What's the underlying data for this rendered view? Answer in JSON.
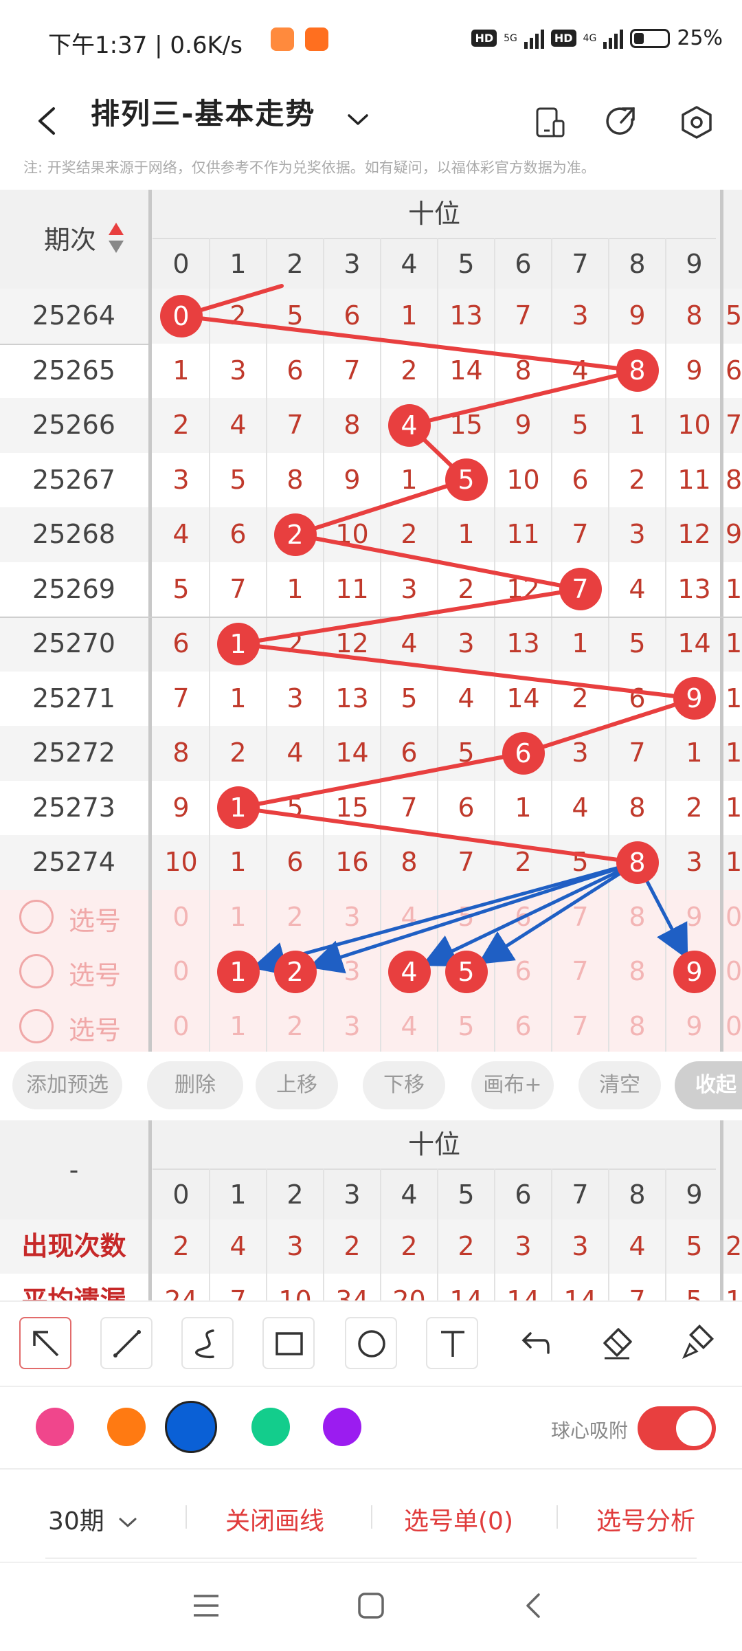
{
  "status_bar": {
    "time": "下午1:37 | 0.6K/s",
    "hd1": "HD",
    "net1": "5G",
    "hd2": "HD",
    "net2": "4G",
    "battery": "25%"
  },
  "header": {
    "back_icon": "chevron-left-icon",
    "title": "排列三-基本走势",
    "dropdown_icon": "chevron-down-icon",
    "icons": [
      "layout-icon",
      "share-icon",
      "settings-hexagon-icon"
    ]
  },
  "notice": "注: 开奖结果来源于网络，仅供参考不作为兑奖依据。如有疑问，以福体彩官方数据为准。",
  "grid": {
    "period_header": "期次",
    "group_header": "十位",
    "digits": [
      "0",
      "1",
      "2",
      "3",
      "4",
      "5",
      "6",
      "7",
      "8",
      "9"
    ],
    "next_digit": "0",
    "rows": [
      {
        "period": "25264",
        "cells": [
          "0",
          "2",
          "5",
          "6",
          "1",
          "13",
          "7",
          "3",
          "9",
          "8"
        ],
        "hit": 0,
        "edge": "5"
      },
      {
        "period": "25265",
        "cells": [
          "1",
          "3",
          "6",
          "7",
          "2",
          "14",
          "8",
          "4",
          "8",
          "9"
        ],
        "hit": 8,
        "edge": "6"
      },
      {
        "period": "25266",
        "cells": [
          "2",
          "4",
          "7",
          "8",
          "4",
          "15",
          "9",
          "5",
          "1",
          "10"
        ],
        "hit": 4,
        "edge": "7"
      },
      {
        "period": "25267",
        "cells": [
          "3",
          "5",
          "8",
          "9",
          "1",
          "5",
          "10",
          "6",
          "2",
          "11"
        ],
        "hit": 5,
        "edge": "8"
      },
      {
        "period": "25268",
        "cells": [
          "4",
          "6",
          "2",
          "10",
          "2",
          "1",
          "11",
          "7",
          "3",
          "12"
        ],
        "hit": 2,
        "edge": "9"
      },
      {
        "period": "25269",
        "cells": [
          "5",
          "7",
          "1",
          "11",
          "3",
          "2",
          "12",
          "7",
          "4",
          "13"
        ],
        "hit": 7,
        "edge": "1"
      },
      {
        "period": "25270",
        "cells": [
          "6",
          "1",
          "2",
          "12",
          "4",
          "3",
          "13",
          "1",
          "5",
          "14"
        ],
        "hit": 1,
        "edge": "1"
      },
      {
        "period": "25271",
        "cells": [
          "7",
          "1",
          "3",
          "13",
          "5",
          "4",
          "14",
          "2",
          "6",
          "9"
        ],
        "hit": 9,
        "edge": "1"
      },
      {
        "period": "25272",
        "cells": [
          "8",
          "2",
          "4",
          "14",
          "6",
          "5",
          "6",
          "3",
          "7",
          "1"
        ],
        "hit": 6,
        "edge": "1"
      },
      {
        "period": "25273",
        "cells": [
          "9",
          "1",
          "5",
          "15",
          "7",
          "6",
          "1",
          "4",
          "8",
          "2"
        ],
        "hit": 1,
        "edge": "1"
      },
      {
        "period": "25274",
        "cells": [
          "10",
          "1",
          "6",
          "16",
          "8",
          "7",
          "2",
          "5",
          "8",
          "3"
        ],
        "hit": 8,
        "edge": "1"
      }
    ],
    "select_rows": [
      {
        "label": "选号",
        "selected": []
      },
      {
        "label": "选号",
        "selected": [
          1,
          2,
          4,
          5,
          9
        ]
      },
      {
        "label": "选号",
        "selected": []
      }
    ]
  },
  "actions": [
    "添加预选",
    "删除",
    "上移",
    "下移",
    "画布+",
    "清空",
    "收起"
  ],
  "stats": {
    "left_header": "-",
    "group_header": "十位",
    "digits": [
      "0",
      "1",
      "2",
      "3",
      "4",
      "5",
      "6",
      "7",
      "8",
      "9"
    ],
    "next_digit": "0",
    "row1_label": "出现次数",
    "row1": [
      "2",
      "4",
      "3",
      "2",
      "2",
      "2",
      "3",
      "3",
      "4",
      "5"
    ],
    "row1_edge": "2",
    "row2_label": "平均遗漏",
    "row2": [
      "24",
      "7",
      "10",
      "34",
      "20",
      "14",
      "14",
      "14",
      "7",
      "5"
    ],
    "row2_edge": "1"
  },
  "toolbar": {
    "tools": [
      "select-arrow-icon",
      "line-icon",
      "curve-icon",
      "rectangle-icon",
      "circle-icon",
      "text-icon",
      "undo-icon",
      "eraser-icon",
      "clear-brush-icon"
    ]
  },
  "colors": {
    "swatches": [
      "#f0468c",
      "#ff7a12",
      "#0a60d6",
      "#13cd8c",
      "#9b1cf0"
    ],
    "selected": "#0a60d6",
    "snap_label": "球心吸附",
    "snap_on": true
  },
  "bottom": {
    "periods": "30期",
    "close_lines": "关闭画线",
    "selection_list": "选号单(0)",
    "selection_analysis": "选号分析"
  },
  "accent": "#e83f3f",
  "arrow_color": "#1f5fc4"
}
